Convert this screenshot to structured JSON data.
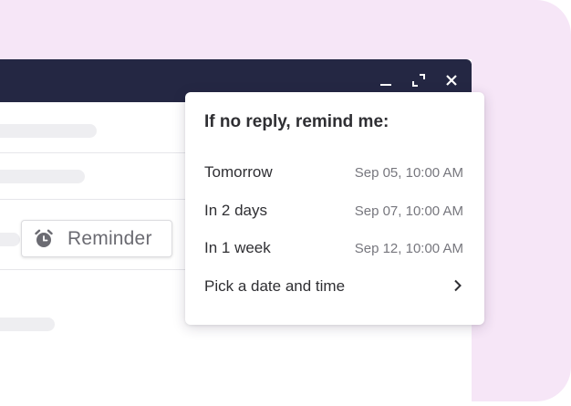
{
  "colors": {
    "background": "#f6e6f7",
    "compose_bar": "#242743",
    "text_primary": "#2f2f33",
    "text_secondary": "#77777e"
  },
  "window_controls": {
    "minimize_icon": "minimize-icon",
    "expand_icon": "expand-icon",
    "close_icon": "close-icon"
  },
  "reminder_chip": {
    "icon": "alarm-clock-icon",
    "label": "Reminder"
  },
  "popover": {
    "title": "If no reply, remind me:",
    "options": [
      {
        "label": "Tomorrow",
        "when": "Sep 05, 10:00 AM"
      },
      {
        "label": "In 2 days",
        "when": "Sep 07, 10:00 AM"
      },
      {
        "label": "In 1 week",
        "when": "Sep 12, 10:00 AM"
      }
    ],
    "custom": {
      "label": "Pick a date and time",
      "icon": "chevron-right-icon"
    }
  }
}
